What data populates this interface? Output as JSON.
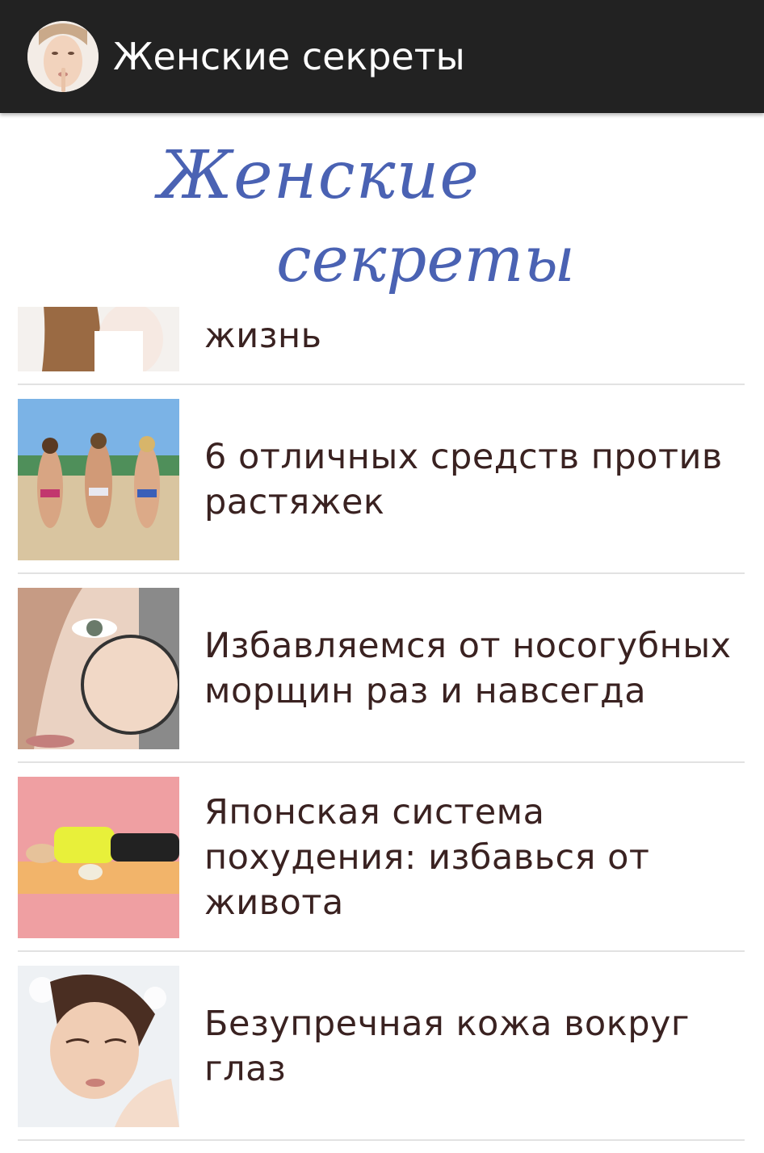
{
  "app": {
    "title": "Женские секреты",
    "avatar_icon": "woman-face-icon"
  },
  "logo": {
    "line1": "Женские",
    "line2": "секреты",
    "color": "#4a62b3"
  },
  "articles": [
    {
      "title": "жизнь",
      "thumb": "woman-hair-photo"
    },
    {
      "title": "6 отличных средств против растяжек",
      "thumb": "beach-bikini-photo"
    },
    {
      "title": "Избавляемся от носогубных морщин раз и навсегда",
      "thumb": "face-magnifier-photo"
    },
    {
      "title": "Японская система похудения: избавься от живота",
      "thumb": "yoga-mat-photo"
    },
    {
      "title": "Безупречная кожа вокруг глаз",
      "thumb": "skin-care-photo"
    }
  ],
  "colors": {
    "action_bar": "#222222",
    "title_text": "#3a2221",
    "divider": "#e2e2e2"
  }
}
